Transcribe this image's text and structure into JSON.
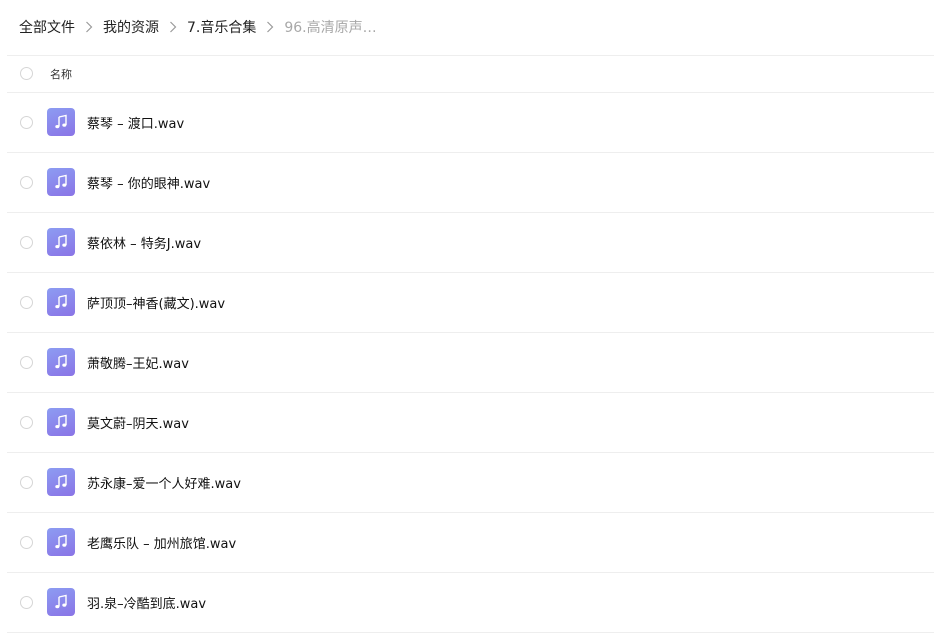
{
  "breadcrumb": {
    "items": [
      "全部文件",
      "我的资源",
      "7.音乐合集"
    ],
    "current": "96.高清原声…"
  },
  "header": {
    "name_label": "名称"
  },
  "files": [
    {
      "name": "蔡琴 – 渡口.wav",
      "icon": "music-note-icon"
    },
    {
      "name": "蔡琴 – 你的眼神.wav",
      "icon": "music-note-icon"
    },
    {
      "name": "蔡依林 – 特务J.wav",
      "icon": "music-note-icon"
    },
    {
      "name": "萨顶顶–神香(藏文).wav",
      "icon": "music-note-icon"
    },
    {
      "name": "萧敬腾–王妃.wav",
      "icon": "music-note-icon"
    },
    {
      "name": "莫文蔚–阴天.wav",
      "icon": "music-note-icon"
    },
    {
      "name": "苏永康–爱一个人好难.wav",
      "icon": "music-note-icon"
    },
    {
      "name": "老鹰乐队 – 加州旅馆.wav",
      "icon": "music-note-icon"
    },
    {
      "name": "羽.泉–冷酷到底.wav",
      "icon": "music-note-icon"
    }
  ],
  "colors": {
    "icon_gradient_start": "#8c9cf2",
    "icon_gradient_end": "#8a74e6",
    "breadcrumb_current": "#a8a8a8",
    "divider": "#eeeeee"
  }
}
